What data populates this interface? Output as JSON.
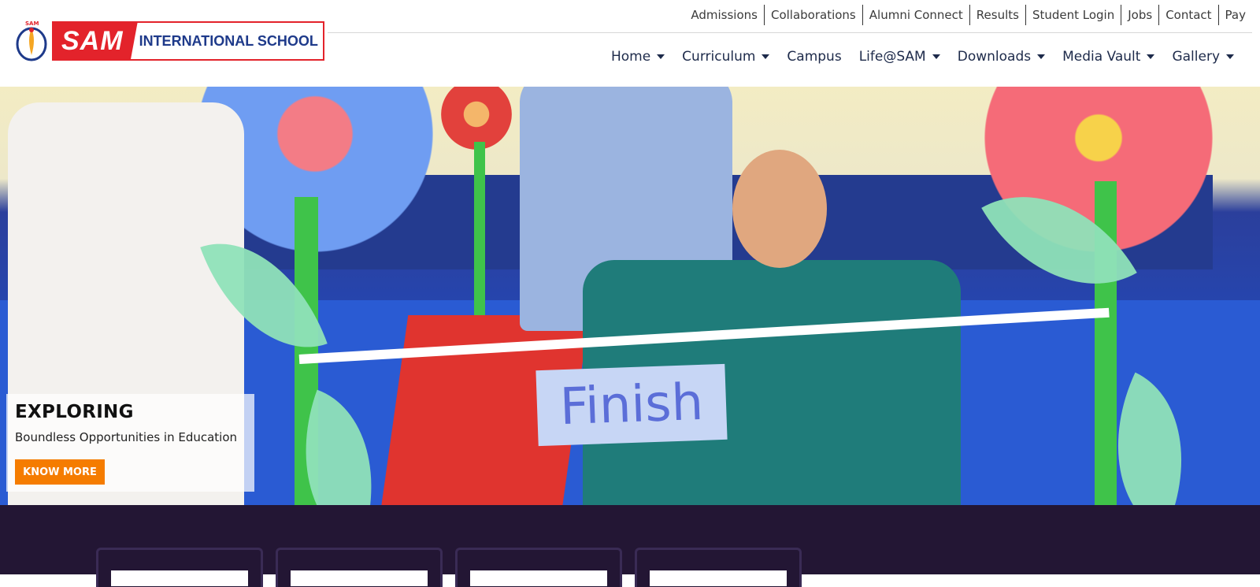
{
  "logo": {
    "emblem_text": "SAM",
    "brand_main": "SAM",
    "brand_rest": "INTERNATIONAL SCHOOL"
  },
  "top_nav": [
    "Admissions",
    "Collaborations",
    "Alumni Connect",
    "Results",
    "Student Login",
    "Jobs",
    "Contact",
    "Pay"
  ],
  "main_nav": [
    {
      "label": "Home",
      "dropdown": true
    },
    {
      "label": "Curriculum",
      "dropdown": true
    },
    {
      "label": "Campus",
      "dropdown": false
    },
    {
      "label": "Life@SAM",
      "dropdown": true
    },
    {
      "label": "Downloads",
      "dropdown": true
    },
    {
      "label": "Media Vault",
      "dropdown": true
    },
    {
      "label": "Gallery",
      "dropdown": true
    }
  ],
  "hero": {
    "sign_text": "Finish",
    "caption_title": "EXPLORING",
    "caption_subtitle": "Boundless Opportunities in Education",
    "cta_label": "KNOW MORE"
  },
  "colors": {
    "brand_red": "#e3232b",
    "brand_blue": "#1e3a8a",
    "cta_orange": "#f57c00",
    "dark_section": "#231634"
  }
}
